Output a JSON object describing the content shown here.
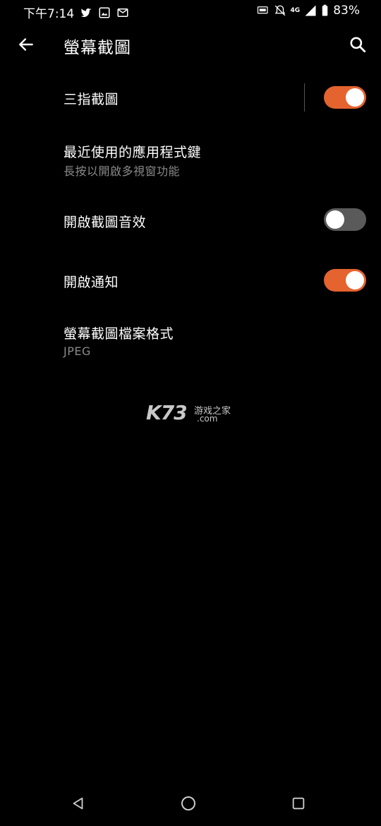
{
  "status_bar": {
    "time": "下午7:14",
    "network": "4G",
    "battery": "83%",
    "icons": [
      "twitter-icon",
      "image-icon",
      "mail-icon",
      "auto-brightness-icon",
      "mute-icon",
      "signal-icon",
      "battery-icon"
    ]
  },
  "app_bar": {
    "title": "螢幕截圖"
  },
  "settings": [
    {
      "title": "三指截圖",
      "toggle": true,
      "state": "on"
    },
    {
      "title": "最近使用的應用程式鍵",
      "subtitle": "長按以開啟多視窗功能"
    },
    {
      "title": "開啟截圖音效",
      "toggle": true,
      "state": "off"
    },
    {
      "title": "開啟通知",
      "toggle": true,
      "state": "on"
    },
    {
      "title": "螢幕截圖檔案格式",
      "subtitle": "JPEG"
    }
  ],
  "watermark": {
    "brand": "K73",
    "tagline": "游戏之家",
    "domain": ".com"
  },
  "colors": {
    "accent": "#e4632f",
    "background": "#000000",
    "secondary_text": "#8a8a8a",
    "toggle_off": "#5a5a5a"
  }
}
